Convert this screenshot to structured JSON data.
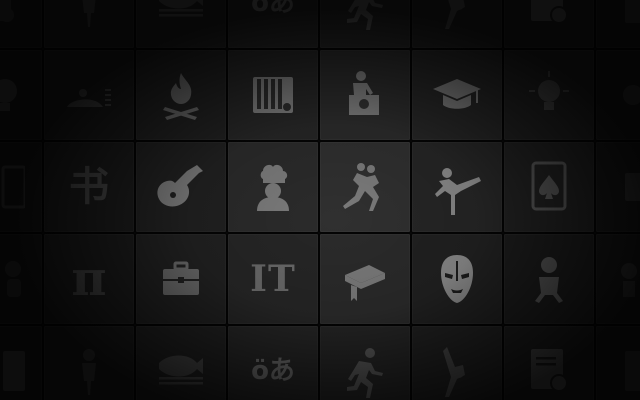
{
  "tiles": {
    "language": {
      "label": "öあ"
    },
    "math": {
      "label": "π"
    },
    "it": {
      "label": "IT"
    },
    "calligraphy": {
      "label": "书"
    }
  }
}
